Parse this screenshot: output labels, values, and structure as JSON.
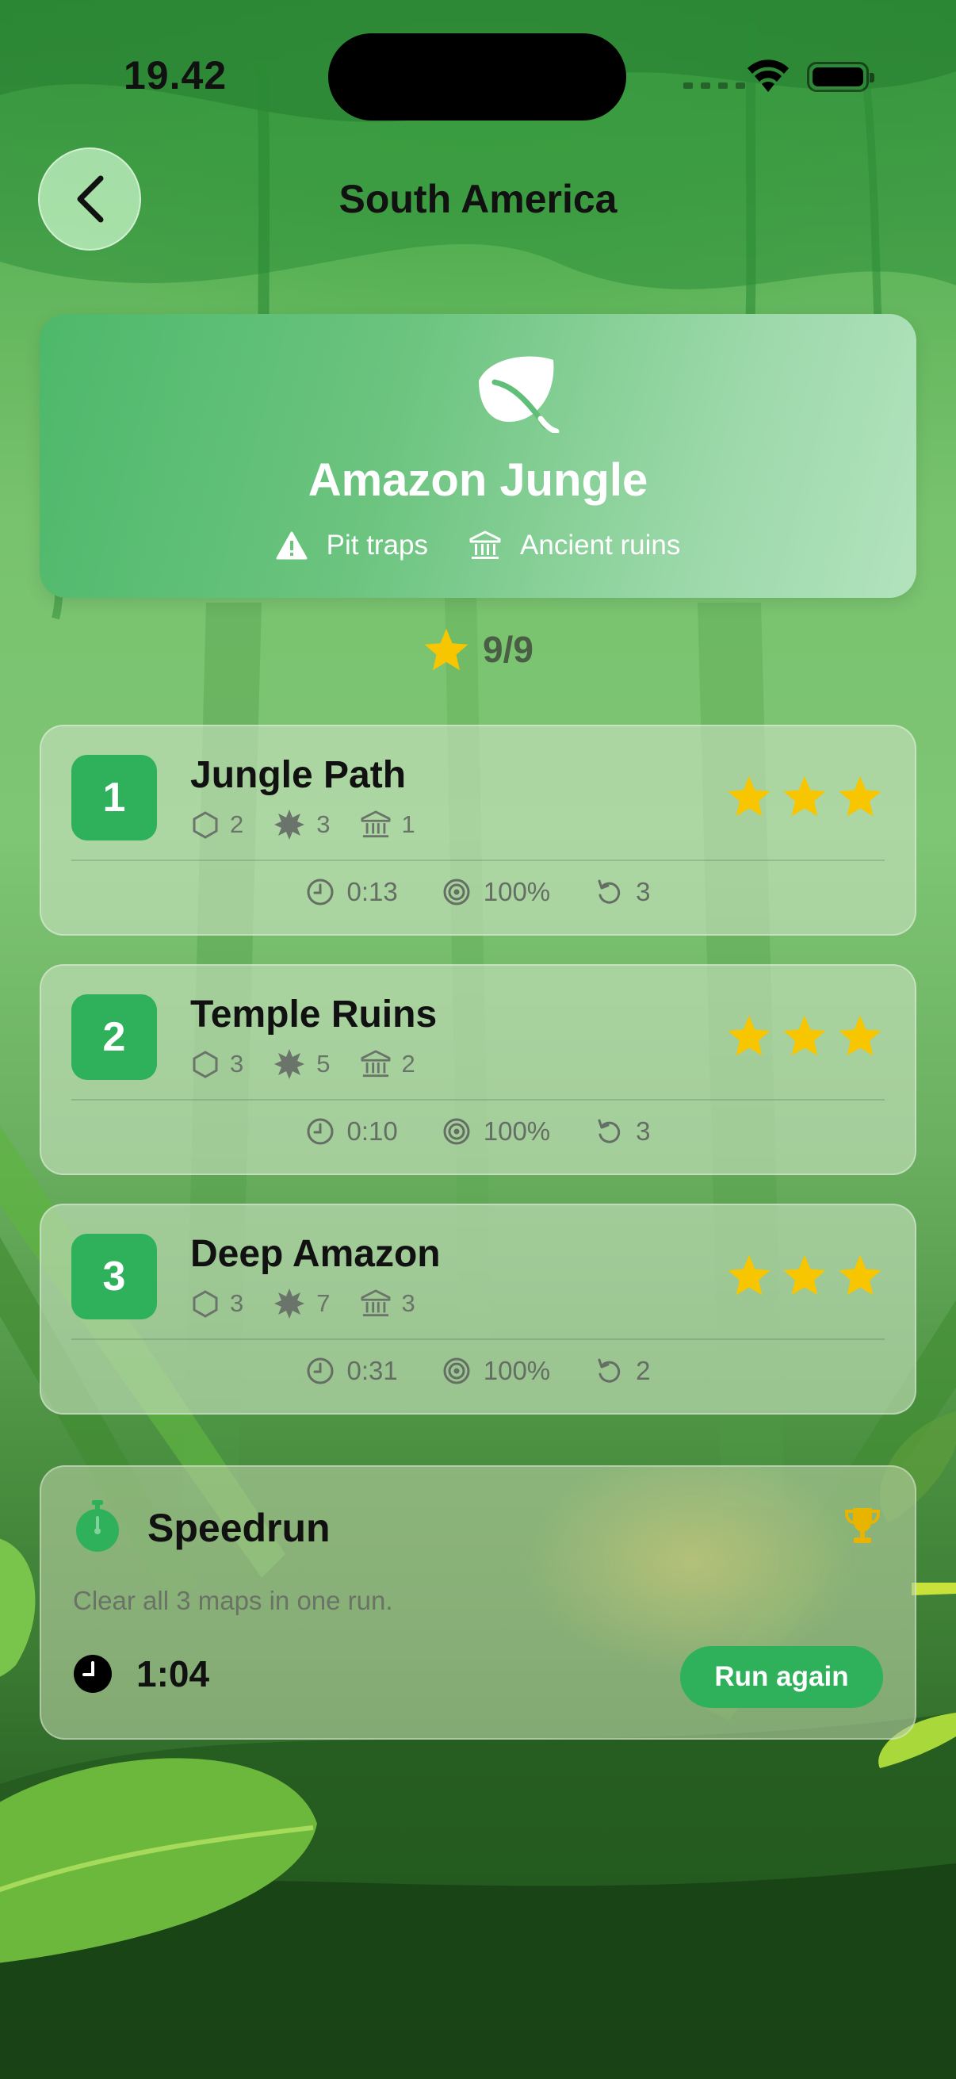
{
  "status_bar": {
    "time": "19.42"
  },
  "header": {
    "title": "South America"
  },
  "hero": {
    "icon": "leaf-icon",
    "title": "Amazon Jungle",
    "tags": [
      {
        "icon": "warning-icon",
        "label": "Pit traps"
      },
      {
        "icon": "museum-icon",
        "label": "Ancient ruins"
      }
    ]
  },
  "summary": {
    "stars_label": "9/9"
  },
  "levels": [
    {
      "number": "1",
      "name": "Jungle Path",
      "hexagons": "2",
      "spikes": "3",
      "ruins": "1",
      "stars": 3,
      "time": "0:13",
      "accuracy": "100%",
      "retries": "3"
    },
    {
      "number": "2",
      "name": "Temple Ruins",
      "hexagons": "3",
      "spikes": "5",
      "ruins": "2",
      "stars": 3,
      "time": "0:10",
      "accuracy": "100%",
      "retries": "3"
    },
    {
      "number": "3",
      "name": "Deep Amazon",
      "hexagons": "3",
      "spikes": "7",
      "ruins": "3",
      "stars": 3,
      "time": "0:31",
      "accuracy": "100%",
      "retries": "2"
    }
  ],
  "speedrun": {
    "title": "Speedrun",
    "description": "Clear all 3 maps in one run.",
    "time": "1:04",
    "button_label": "Run again"
  },
  "colors": {
    "accent": "#2eb15a",
    "star": "#f7c600",
    "trophy": "#e9b400"
  }
}
